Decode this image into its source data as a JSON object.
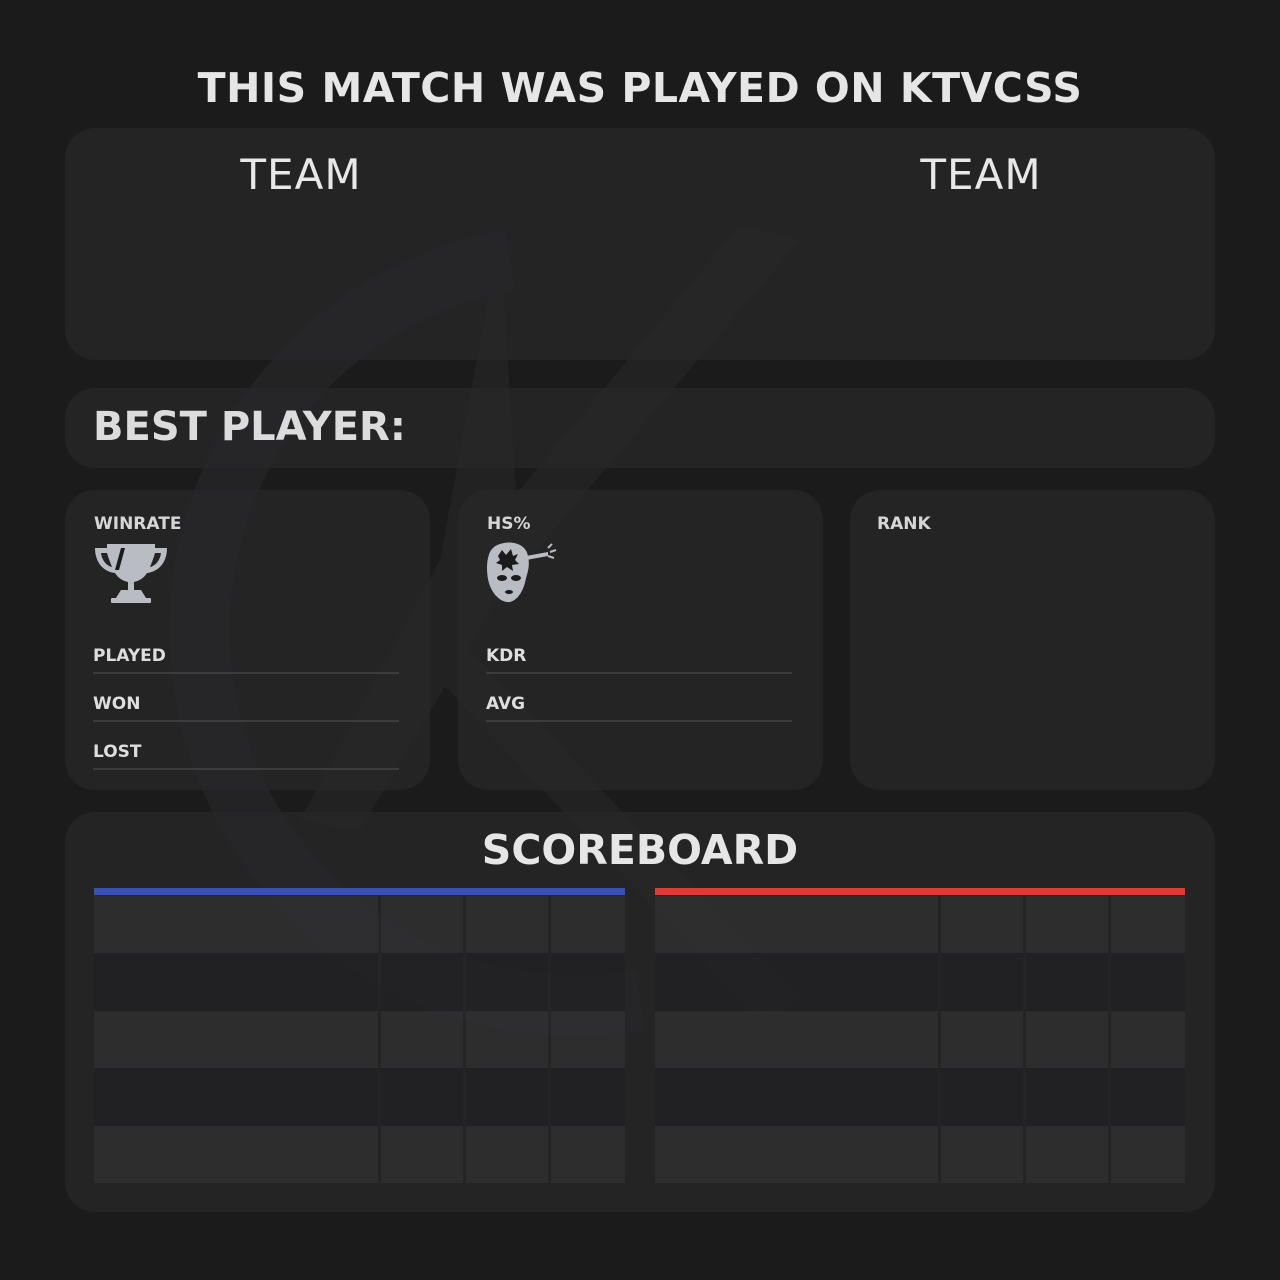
{
  "header": {
    "title": "THIS MATCH WAS PLAYED ON KTVCSS"
  },
  "teams": {
    "left_label": "TEAM",
    "right_label": "TEAM"
  },
  "best_player": {
    "label": "BEST PLAYER:"
  },
  "cards": {
    "winrate": {
      "label": "WINRATE",
      "icon": "trophy-icon",
      "rows": [
        {
          "label": "PLAYED"
        },
        {
          "label": "WON"
        },
        {
          "label": "LOST"
        }
      ]
    },
    "hs": {
      "label": "HS%",
      "icon": "headshot-mask-icon",
      "rows": [
        {
          "label": "KDR"
        },
        {
          "label": "AVG"
        }
      ]
    },
    "rank": {
      "label": "RANK"
    }
  },
  "scoreboard": {
    "title": "SCOREBOARD",
    "team_colors": {
      "left": "#3b4fb8",
      "right": "#e53935"
    },
    "rows_per_team": 5
  },
  "colors": {
    "background": "#1b1b1c",
    "panel": "#282829",
    "text": "#e4e4e4"
  }
}
